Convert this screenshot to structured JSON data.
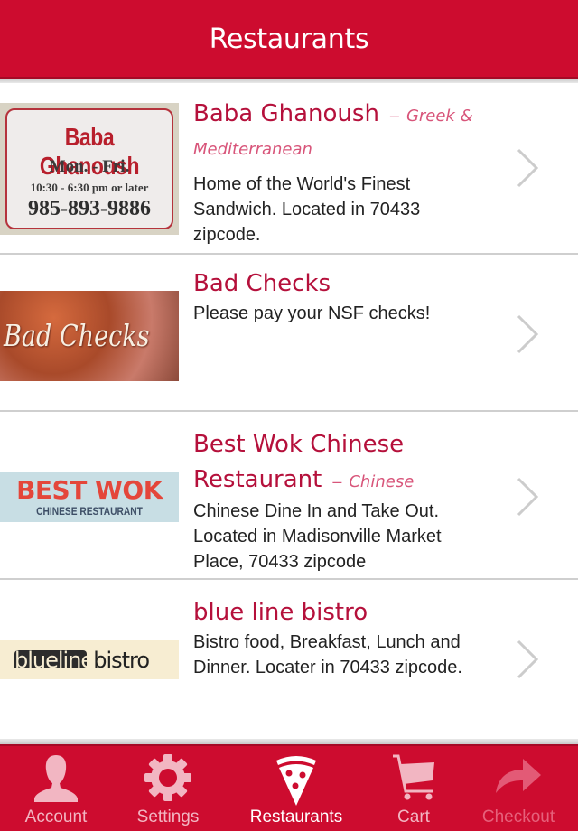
{
  "header": {
    "title": "Restaurants"
  },
  "restaurants": [
    {
      "name": "Baba Ghanoush",
      "cuisine": "Greek & Mediterranean",
      "separator": "–",
      "description": "Home of the World's Finest Sandwich. Located in 70433 zipcode.",
      "logo": {
        "line1": "Baba Ghanoush",
        "line2": "Mon. - Fri.",
        "line3": "10:30 - 6:30 pm or later",
        "line4": "985-893-9886"
      }
    },
    {
      "name": "Bad Checks",
      "cuisine": "",
      "description": "Please pay your NSF checks!",
      "logo": {
        "line1": "Bad Checks"
      }
    },
    {
      "name": "Best Wok Chinese Restaurant",
      "cuisine": "Chinese",
      "separator": "–",
      "description": "Chinese Dine In and Take Out. Located in Madisonville Market Place, 70433 zipcode",
      "logo": {
        "line1": "BEST WOK",
        "line2": "CHINESE RESTAURANT"
      }
    },
    {
      "name": "blue line bistro",
      "cuisine": "",
      "description": "Bistro food, Breakfast, Lunch and Dinner. Locater in 70433 zipcode.",
      "logo": {
        "part1": "blueline",
        "part2": "bistro"
      }
    }
  ],
  "tabbar": {
    "items": [
      {
        "label": "Account",
        "icon": "person-icon",
        "state": "normal"
      },
      {
        "label": "Settings",
        "icon": "gear-icon",
        "state": "normal"
      },
      {
        "label": "Restaurants",
        "icon": "pizza-slice-icon",
        "state": "active"
      },
      {
        "label": "Cart",
        "icon": "cart-icon",
        "state": "normal"
      },
      {
        "label": "Checkout",
        "icon": "share-arrow-icon",
        "state": "disabled"
      }
    ]
  },
  "colors": {
    "brand": "#cd0c2f",
    "name_text": "#b5103b",
    "cuisine_text": "#d8557a",
    "tab_inactive": "#f2b6c2",
    "tab_active": "#ffffff",
    "tab_disabled": "#e6617b"
  }
}
